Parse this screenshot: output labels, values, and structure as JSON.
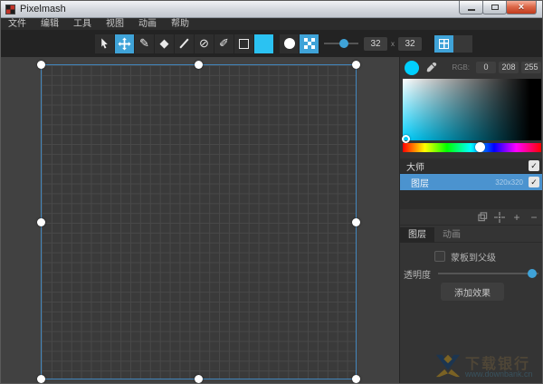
{
  "window": {
    "title": "Pixelmash"
  },
  "menu": {
    "items": [
      "文件",
      "编辑",
      "工具",
      "视图",
      "动画",
      "帮助"
    ]
  },
  "toolbar": {
    "width_value": "32",
    "times": "x",
    "height_value": "32"
  },
  "icons": {
    "pencil": "✎",
    "eraser": "◆",
    "shade": "⊘",
    "brush": "✐",
    "check": "✓",
    "plus": "+",
    "minus": "−",
    "maximize": "",
    "close": "×"
  },
  "colors": {
    "accent": "#3fa3d8",
    "toolbar_swatch": "#2bc2f2",
    "current_color": "#00d0ff",
    "selected_layer": "#4b93cf"
  },
  "color_panel": {
    "rgb_label": "RGB:",
    "r": "0",
    "g": "208",
    "b": "255"
  },
  "layers": {
    "master_name": "大师",
    "layer_name": "图层",
    "layer_size": "320x320"
  },
  "inspector": {
    "tab_layer": "图层",
    "tab_animation": "动画",
    "mask_label": "蒙板到父级",
    "opacity_label": "透明度",
    "add_effect_label": "添加效果"
  },
  "watermark": {
    "title": "下载银行",
    "url": "www.downbank.cn"
  }
}
